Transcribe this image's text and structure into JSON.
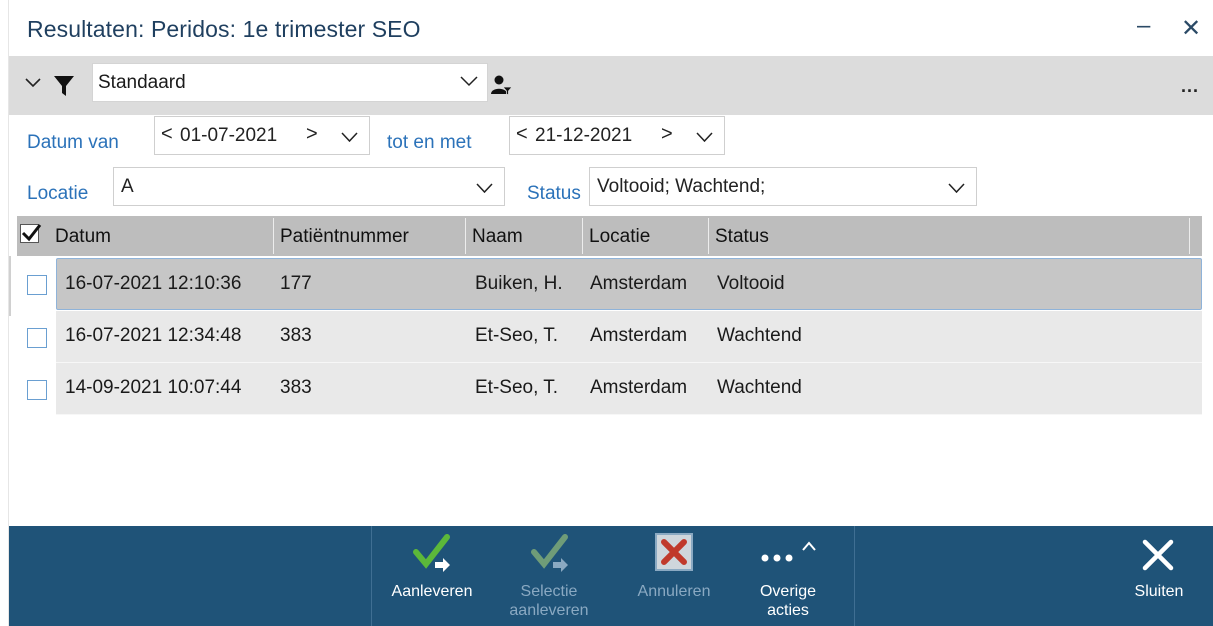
{
  "window": {
    "title": "Resultaten: Peridos: 1e trimester SEO",
    "minimize_glyph": "–",
    "close_glyph": "✕"
  },
  "filterbar": {
    "collapse_icon": "chevron-down-icon",
    "filter_icon": "funnel-icon",
    "preset_value": "Standaard",
    "user_icon": "user-filter-icon",
    "more_glyph": "..."
  },
  "form": {
    "date_from_label": "Datum van",
    "date_from_value": "01-07-2021",
    "date_to_label": "tot en met",
    "date_to_value": "21-12-2021",
    "location_label": "Locatie",
    "location_value": "A",
    "status_label": "Status",
    "status_value": "Voltooid; Wachtend;"
  },
  "grid": {
    "columns": [
      "Datum",
      "Patiëntnummer",
      "Naam",
      "Locatie",
      "Status"
    ],
    "rows": [
      {
        "datum": "16-07-2021 12:10:36",
        "patientnummer": "177",
        "naam": "Buiken, H.",
        "locatie": "Amsterdam",
        "status": "Voltooid",
        "selected": true
      },
      {
        "datum": "16-07-2021 12:34:48",
        "patientnummer": "383",
        "naam": "Et-Seo, T.",
        "locatie": "Amsterdam",
        "status": "Wachtend",
        "selected": false
      },
      {
        "datum": "14-09-2021 10:07:44",
        "patientnummer": "383",
        "naam": "Et-Seo, T.",
        "locatie": "Amsterdam",
        "status": "Wachtend",
        "selected": false
      }
    ]
  },
  "toolbar": {
    "aanleveren": "Aanleveren",
    "selectie_line1": "Selectie",
    "selectie_line2": "aanleveren",
    "annuleren": "Annuleren",
    "overige_line1": "Overige",
    "overige_line2": "acties",
    "sluiten": "Sluiten"
  },
  "colors": {
    "toolbar_bg": "#1f5378",
    "label_blue": "#2b72b9",
    "check_green": "#5cb83a"
  }
}
